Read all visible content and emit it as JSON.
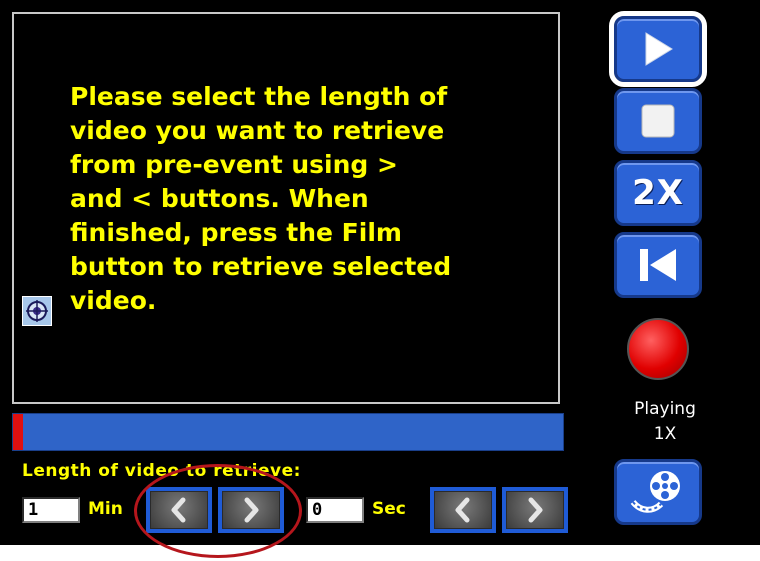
{
  "video_panel": {
    "message": "Please select the length of\nvideo you want to retrieve\nfrom pre-event using >\nand < buttons. When\nfinished, press the Film\nbutton to retrieve selected\nvideo.",
    "target_icon": "crosshair-target-icon"
  },
  "progress": {
    "marker_color": "#e01010",
    "bar_color": "#2f64c8"
  },
  "retrieve": {
    "label": "Length of video to retrieve:",
    "minutes": {
      "value": "1",
      "unit": "Min",
      "decrease_icon": "chevron-left-icon",
      "increase_icon": "chevron-right-icon"
    },
    "seconds": {
      "value": "0",
      "unit": "Sec",
      "decrease_icon": "chevron-left-icon",
      "increase_icon": "chevron-right-icon"
    }
  },
  "controls": {
    "play_icon": "play-icon",
    "stop_icon": "stop-icon",
    "speed_label": "2X",
    "rewind_icon": "skip-to-start-icon",
    "record_icon": "record-icon",
    "film_icon": "film-reel-icon"
  },
  "status": {
    "state": "Playing",
    "speed": "1X"
  },
  "annotation": {
    "color": "#b5161c"
  }
}
